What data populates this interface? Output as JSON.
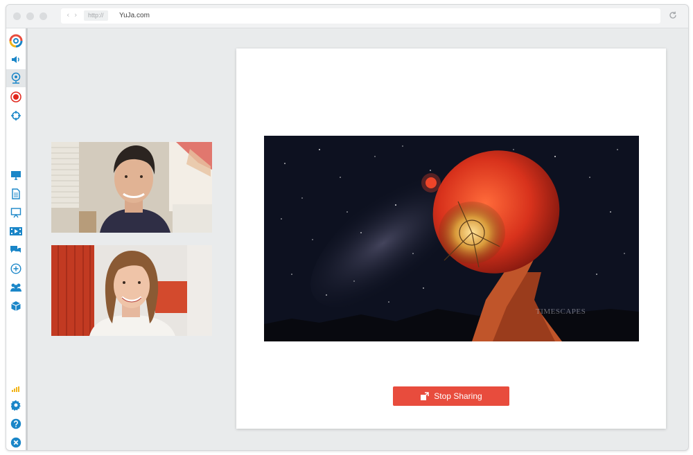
{
  "browser": {
    "protocol": "http://",
    "domain": "YuJa.com"
  },
  "sidebar": {
    "items": [
      {
        "name": "yuja-logo-icon",
        "interactable": false
      },
      {
        "name": "speaker-icon",
        "interactable": true
      },
      {
        "name": "webcam-icon",
        "interactable": true,
        "active": true
      },
      {
        "name": "record-icon",
        "interactable": true
      },
      {
        "name": "crosshair-icon",
        "interactable": true
      },
      {
        "name": "desktop-icon",
        "interactable": true
      },
      {
        "name": "document-icon",
        "interactable": true
      },
      {
        "name": "whiteboard-icon",
        "interactable": true
      },
      {
        "name": "video-icon",
        "interactable": true
      },
      {
        "name": "chat-icon",
        "interactable": true
      },
      {
        "name": "add-icon",
        "interactable": true
      },
      {
        "name": "participants-icon",
        "interactable": true
      },
      {
        "name": "box-icon",
        "interactable": true
      },
      {
        "name": "signal-icon",
        "interactable": false
      },
      {
        "name": "gear-icon",
        "interactable": true
      },
      {
        "name": "help-icon",
        "interactable": true
      },
      {
        "name": "close-icon",
        "interactable": true
      }
    ]
  },
  "share": {
    "watermark": "TIMESCAPES",
    "stop_label": "Stop Sharing"
  },
  "colors": {
    "accent_red": "#e84c3d",
    "icon_blue": "#1a86c8",
    "record_red": "#e1261c",
    "signal_yellow": "#f2b51b"
  }
}
